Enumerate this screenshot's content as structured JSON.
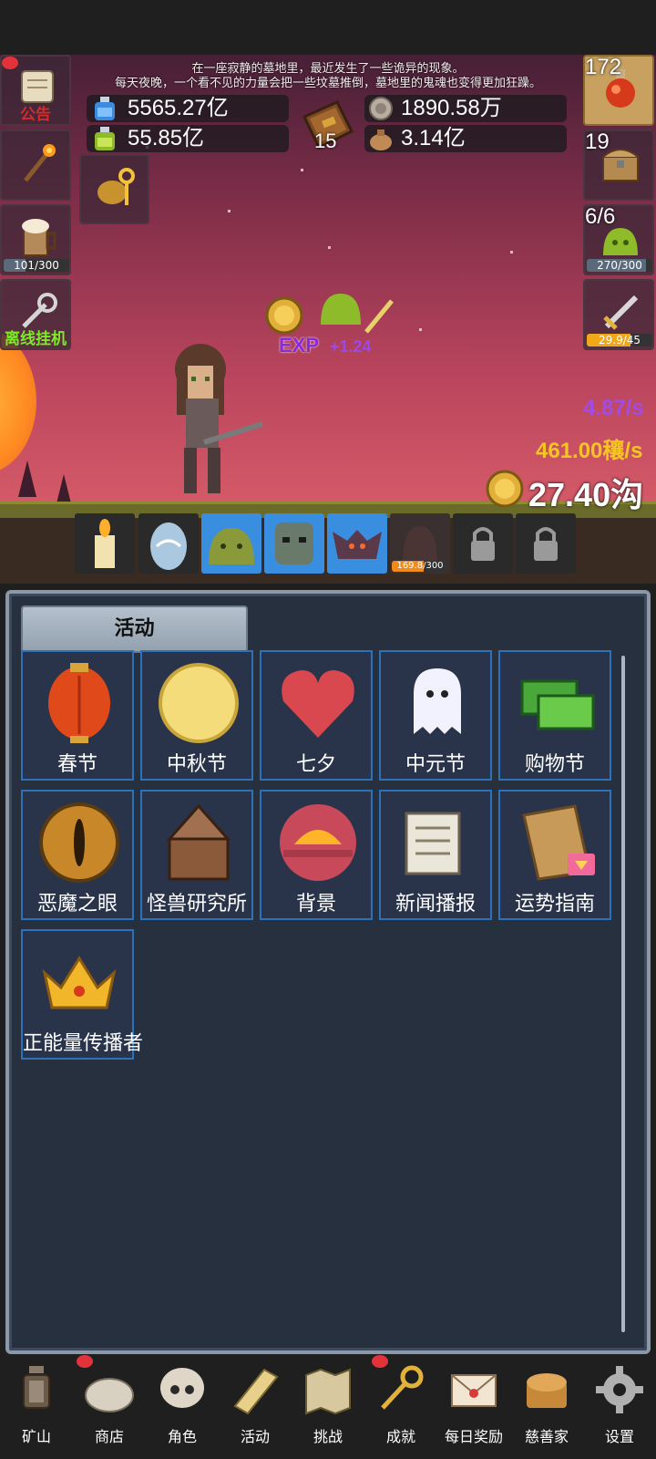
{
  "story": {
    "line1": "在一座寂静的墓地里，最近发生了一些诡异的现象。",
    "line2": "每天夜晚，一个看不见的力量会把一些坟墓推倒，墓地里的鬼魂也变得更加狂躁。"
  },
  "resources": {
    "blue_potion": "5565.27亿",
    "green_potion": "55.85亿",
    "book_count": "15",
    "silver": "1890.58万",
    "bag": "3.14亿"
  },
  "left_buttons": {
    "announcement_label": "公告",
    "mug_bar": "101/300",
    "mug_fill": 0.34,
    "offline_label": "离线挂机"
  },
  "right_buttons": {
    "potion_count": "172",
    "chest_count": "19",
    "slime_count": "6/6",
    "slime_bar": "270/300",
    "slime_fill": 0.9,
    "sword_bar": "29.9/45",
    "sword_fill": 0.66
  },
  "battle": {
    "exp_label": "EXP",
    "exp_gain": "+1.24",
    "rate_purple": "4.87/s",
    "rate_gold": "461.00穰/s",
    "gold_total": "27.40沟"
  },
  "monster_slots": {
    "shade_bar": "169.8/300",
    "shade_fill": 0.57
  },
  "panel": {
    "title": "活动",
    "tiles": [
      {
        "label": "春节",
        "icon": "lantern-icon"
      },
      {
        "label": "中秋节",
        "icon": "moon-icon"
      },
      {
        "label": "七夕",
        "icon": "heart-icon"
      },
      {
        "label": "中元节",
        "icon": "ghost-icon"
      },
      {
        "label": "购物节",
        "icon": "money-icon"
      },
      {
        "label": "恶魔之眼",
        "icon": "demon-eye-icon"
      },
      {
        "label": "怪兽研究所",
        "icon": "monster-lab-icon"
      },
      {
        "label": "背景",
        "icon": "sunset-icon"
      },
      {
        "label": "新闻播报",
        "icon": "newspaper-icon"
      },
      {
        "label": "运势指南",
        "icon": "fortune-map-icon"
      },
      {
        "label": "正能量传播者",
        "icon": "crown-icon"
      }
    ]
  },
  "nav": [
    {
      "label": "矿山",
      "icon": "lantern-icon"
    },
    {
      "label": "商店",
      "icon": "shop-stone-icon"
    },
    {
      "label": "角色",
      "icon": "skull-icon"
    },
    {
      "label": "活动",
      "icon": "scroll-icon"
    },
    {
      "label": "挑战",
      "icon": "map-icon"
    },
    {
      "label": "成就",
      "icon": "key-icon"
    },
    {
      "label": "每日奖励",
      "icon": "envelope-icon"
    },
    {
      "label": "慈善家",
      "icon": "bread-icon"
    },
    {
      "label": "设置",
      "icon": "gear-icon"
    }
  ],
  "colors": {
    "tile_border": "#2d72b8",
    "panel_bg": "#26303f",
    "gold_text": "#f5c623",
    "purple_text": "#a24ce8",
    "notice_red": "#e2323a"
  }
}
